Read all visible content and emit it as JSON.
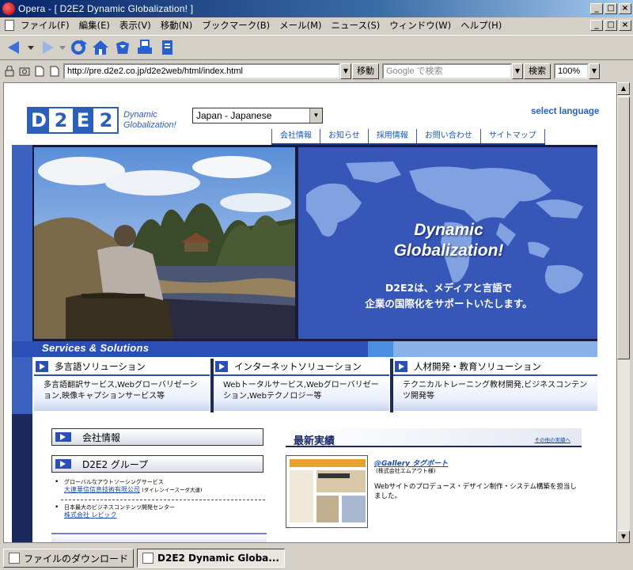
{
  "window": {
    "title": "Opera - [ D2E2 Dynamic Globalization! ]",
    "buttons": [
      "_",
      "□",
      "×"
    ]
  },
  "menubar": {
    "items": [
      "ファイル(F)",
      "編集(E)",
      "表示(V)",
      "移動(N)",
      "ブックマーク(B)",
      "メール(M)",
      "ニュース(S)",
      "ウィンドウ(W)",
      "ヘルプ(H)"
    ]
  },
  "addressbar": {
    "url": "http://pre.d2e2.co.jp/d2e2web/html/index.html",
    "go_label": "移動",
    "search_placeholder": "Google で検索",
    "search_label": "検索",
    "zoom": "100%"
  },
  "page": {
    "logo_letters": [
      "D",
      "2",
      "E",
      "2"
    ],
    "tagline_1": "Dynamic",
    "tagline_2": "Globalization!",
    "language_select": "Japan - Japanese",
    "select_language": "select language",
    "nav": [
      "会社情報",
      "お知らせ",
      "採用情報",
      "お問い合わせ",
      "サイトマップ"
    ],
    "hero": {
      "title_1": "Dynamic",
      "title_2": "Globalization!",
      "sub_1": "D2E2は、メディアと言語で",
      "sub_2": "企業の国際化をサポートいたします。"
    },
    "services_label": "Services & Solutions",
    "services": [
      {
        "title": "多言語ソリューション",
        "desc": "多言語翻訳サービス,Webグローバリゼーション,映像キャプションサービス等"
      },
      {
        "title": "インターネットソリューション",
        "desc": "Webトータルサービス,Webグローバリゼーション,Webテクノロジー等"
      },
      {
        "title": "人材開発・教育ソリューション",
        "desc": "テクニカルトレーニング教材開発,ビジネスコンテンツ開発等"
      }
    ],
    "side_buttons": [
      "会社情報",
      "D2E2 グループ"
    ],
    "group": [
      {
        "caption": "グローバルなアウトソーシングサービス",
        "link": "大連華信信息技術有限公司",
        "note": "(ダイレンイースーダ大連)"
      },
      {
        "caption": "日本最大のビジネスコンテンツ開発センター",
        "link": "株式会社 レビック",
        "note": ""
      }
    ],
    "news": {
      "header": "最新実績",
      "more": "その他の実績へ",
      "title": "@Gallery タグボート",
      "company": "(株式会社エムアウト様)",
      "desc": "Webサイトのプロデュース・デザイン制作・システム構築を担当しました。"
    }
  },
  "taskbar": {
    "items": [
      "ファイルのダウンロード",
      "D2E2 Dynamic Globa..."
    ]
  },
  "colors": {
    "brand_blue": "#2c5fb8",
    "titlebar": "#0a246a"
  }
}
